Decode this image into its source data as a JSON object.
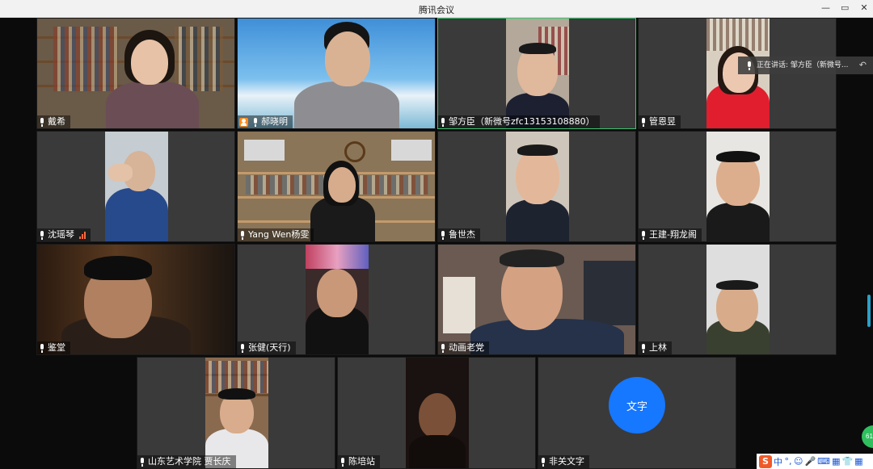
{
  "window": {
    "title": "腾讯会议",
    "minimize": "—",
    "restore": "▭",
    "close": "✕"
  },
  "speaking_banner": {
    "text": "正在讲话: 邹方臣（新微号...",
    "back_icon": "back-arrow-icon"
  },
  "participants": [
    {
      "name": "戴希",
      "mic": "on"
    },
    {
      "name": "郝晓明",
      "mic": "on",
      "host": true
    },
    {
      "name": "邹方臣（新微号zfc13153108880）",
      "mic": "on",
      "active": true
    },
    {
      "name": "管恩昱",
      "mic": "on"
    },
    {
      "name": "沈瑶琴",
      "mic": "on",
      "signal": "weak"
    },
    {
      "name": "Yang Wen杨雯",
      "mic": "on"
    },
    {
      "name": "鲁世杰",
      "mic": "on"
    },
    {
      "name": "王建-翔龙阁",
      "mic": "on"
    },
    {
      "name": "鉴堂",
      "mic": "on"
    },
    {
      "name": "张健(天行)",
      "mic": "on"
    },
    {
      "name": "动画老党",
      "mic": "on"
    },
    {
      "name": "上林",
      "mic": "on"
    },
    {
      "name": "山东艺术学院 贾长庆",
      "mic": "on"
    },
    {
      "name": "陈培站",
      "mic": "on"
    },
    {
      "name": "非关文字",
      "mic": "on",
      "avatar_text": "文字"
    }
  ],
  "ime_bar": {
    "logo": "S",
    "items": [
      "中",
      "°,",
      "☺",
      "🎤",
      "⌨",
      "▦",
      "👕",
      "▦"
    ]
  },
  "side_badge": "61",
  "colors": {
    "active_border": "#3ec46d",
    "avatar_blue": "#1677ff",
    "host_orange": "#ff8a1f"
  }
}
